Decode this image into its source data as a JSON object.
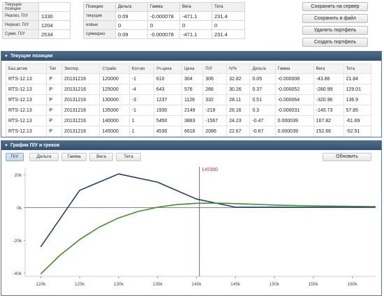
{
  "summary_left": [
    {
      "label": "Текущие позиции",
      "value": ""
    },
    {
      "label": "Реализ. П/У",
      "value": "1330"
    },
    {
      "label": "Нереал. П/У",
      "value": "1204"
    },
    {
      "label": "Сумм. П/У",
      "value": "2534"
    }
  ],
  "summary_right": {
    "headers": [
      "Позиции:",
      "Дельта",
      "Гамма",
      "Вега",
      "Тета"
    ],
    "rows": [
      [
        "текущие",
        "0.09",
        "-0.000078",
        "-471.1",
        "231.4"
      ],
      [
        "новые",
        "0",
        "0",
        "0",
        "0"
      ],
      [
        "суммарно",
        "0.09",
        "-0.000078",
        "-471.1",
        "231.4"
      ]
    ]
  },
  "buttons": {
    "save_server": "Сохранить на сервер",
    "save_file": "Сохранить в файл",
    "delete_portfolio": "Удалить портфель",
    "create_portfolio": "Создать портфель"
  },
  "positions_panel": {
    "title": "Текущие позиции",
    "columns": [
      "Баз.актив",
      "Тип",
      "Экспир.",
      "Страйк",
      "Кол-во",
      "Уч.цена",
      "Цена",
      "П/У",
      "IV%",
      "Дельта",
      "Гамма",
      "Вега",
      "Тета"
    ],
    "rows": [
      [
        "RTS-12.13",
        "P",
        "20131216",
        "120000",
        "-1",
        "610",
        "304",
        "306",
        "32.82",
        "0.05",
        "-0.000008",
        "-43.86",
        "21.84"
      ],
      [
        "RTS-12.13",
        "P",
        "20131216",
        "125000",
        "-4",
        "643",
        "576",
        "266",
        "30.26",
        "0.37",
        "-0.000052",
        "-280.99",
        "129.01"
      ],
      [
        "RTS-12.13",
        "P",
        "20131216",
        "130000",
        "-3",
        "1237",
        "1126",
        "332",
        "28.11",
        "0.51",
        "-0.000064",
        "-320.96",
        "136.9"
      ],
      [
        "RTS-12.13",
        "P",
        "20131216",
        "135000",
        "-1",
        "1930",
        "2149",
        "-219",
        "26.16",
        "0.3",
        "-0.000031",
        "-145.73",
        "57.85"
      ],
      [
        "RTS-12.13",
        "P",
        "20131216",
        "140000",
        "1",
        "5450",
        "3883",
        "-1567",
        "24.23",
        "-0.47",
        "0.000039",
        "167.82",
        "-61.69"
      ],
      [
        "RTS-12.13",
        "P",
        "20131216",
        "145000",
        "1",
        "4530",
        "6616",
        "2086",
        "22.67",
        "-0.67",
        "0.000039",
        "152.66",
        "-52.51"
      ]
    ]
  },
  "chart_panel": {
    "title": "График П/У и греков",
    "tabs": [
      "П/У",
      "Дельта",
      "Гамма",
      "Вега",
      "Тета"
    ],
    "active_tab": "П/У",
    "refresh_label": "Обновить"
  },
  "chart_data": {
    "type": "line",
    "title": "",
    "xlabel": "",
    "ylabel": "",
    "xlim": [
      118000,
      163000
    ],
    "ylim": [
      -42000,
      24000
    ],
    "x_ticks": [
      120000,
      125000,
      130000,
      135000,
      140000,
      145000,
      150000,
      155000,
      160000
    ],
    "x_tick_labels": [
      "120k",
      "125k",
      "130k",
      "135k",
      "140k",
      "145k",
      "150k",
      "155k",
      "160k"
    ],
    "y_ticks": [
      20000,
      0,
      -20000,
      -40000
    ],
    "y_tick_labels": [
      "20k",
      "0k",
      "-20k",
      "-40k"
    ],
    "marker": {
      "x": 140380,
      "label": "140380"
    },
    "series": [
      {
        "color": "#1f3f6e",
        "points": [
          [
            120000,
            -24000
          ],
          [
            125000,
            10500
          ],
          [
            130000,
            20500
          ],
          [
            135000,
            15500
          ],
          [
            140000,
            5200
          ],
          [
            145000,
            200
          ],
          [
            150000,
            200
          ],
          [
            155000,
            200
          ],
          [
            160000,
            200
          ],
          [
            163000,
            200
          ]
        ]
      },
      {
        "color": "#3f8f2a",
        "points": [
          [
            120000,
            -40500
          ],
          [
            122500,
            -29000
          ],
          [
            125000,
            -19500
          ],
          [
            127500,
            -12000
          ],
          [
            130000,
            -6300
          ],
          [
            132500,
            -2400
          ],
          [
            135000,
            200
          ],
          [
            137500,
            1800
          ],
          [
            140000,
            2600
          ],
          [
            142500,
            2700
          ],
          [
            145000,
            2400
          ],
          [
            150000,
            1500
          ],
          [
            155000,
            1000
          ],
          [
            160000,
            700
          ],
          [
            163000,
            600
          ]
        ]
      }
    ],
    "zero_line_color": "#c0392b",
    "grid": false
  }
}
